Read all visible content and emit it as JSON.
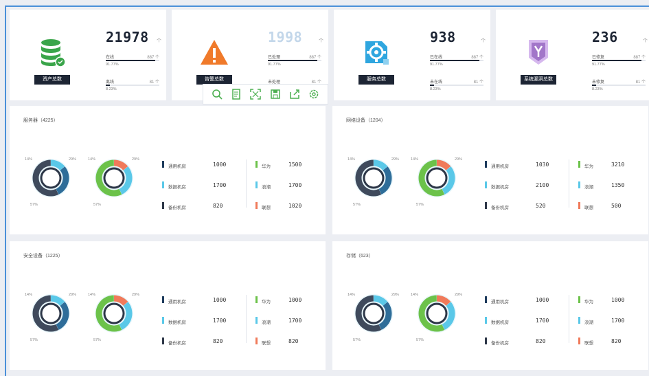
{
  "cards": [
    {
      "tag": "资产总数",
      "number": "21978",
      "unit": "个",
      "rows": [
        {
          "label": "在线",
          "value": "887 个",
          "pct": "91.77%",
          "fill": 0.92
        },
        {
          "label": "离线",
          "value": "81 个",
          "pct": "8.23%",
          "fill": 0.08
        }
      ],
      "color": "#3aa54a",
      "icon": "database-check-icon",
      "light": false
    },
    {
      "tag": "告警总数",
      "number": "1998",
      "unit": "个",
      "rows": [
        {
          "label": "已处理",
          "value": "887 个",
          "pct": "91.77%",
          "fill": 0.92
        },
        {
          "label": "未处理",
          "value": "81 个",
          "pct": "8.23%",
          "fill": 0.08
        }
      ],
      "color": "#f07a2a",
      "icon": "warning-triangle-icon",
      "light": true
    },
    {
      "tag": "服务总数",
      "number": "938",
      "unit": "个",
      "rows": [
        {
          "label": "已在线",
          "value": "887 个",
          "pct": "91.77%",
          "fill": 0.92
        },
        {
          "label": "未在线",
          "value": "81 个",
          "pct": "8.23%",
          "fill": 0.08
        }
      ],
      "color": "#2fa6df",
      "icon": "gear-service-icon",
      "light": false
    },
    {
      "tag": "系统漏洞总数",
      "number": "236",
      "unit": "个",
      "rows": [
        {
          "label": "已修复",
          "value": "887 个",
          "pct": "91.77%",
          "fill": 0.92
        },
        {
          "label": "未修复",
          "value": "81 个",
          "pct": "8.23%",
          "fill": 0.08
        }
      ],
      "color": "#a276c9",
      "icon": "shield-vulnerability-icon",
      "light": false
    }
  ],
  "toolbar": [
    "zoom-icon",
    "document-icon",
    "fullscreen-icon",
    "save-icon",
    "export-icon",
    "settings-icon"
  ],
  "panels": [
    {
      "title": "服务器（4225）",
      "left": [
        {
          "label": "通用机房",
          "value": "1000",
          "color": "#1d3b5c"
        },
        {
          "label": "数据机房",
          "value": "1700",
          "color": "#5ac8e8"
        },
        {
          "label": "备份机房",
          "value": "820",
          "color": "#2d3748"
        }
      ],
      "right": [
        {
          "label": "华为",
          "value": "1500",
          "color": "#6cc24a"
        },
        {
          "label": "浪潮",
          "value": "1700",
          "color": "#5ac8e8"
        },
        {
          "label": "联想",
          "value": "1020",
          "color": "#f07a5a"
        }
      ]
    },
    {
      "title": "网络设备（1204）",
      "left": [
        {
          "label": "通用机房",
          "value": "1030",
          "color": "#1d3b5c"
        },
        {
          "label": "数据机房",
          "value": "2100",
          "color": "#5ac8e8"
        },
        {
          "label": "备份机房",
          "value": "520",
          "color": "#2d3748"
        }
      ],
      "right": [
        {
          "label": "华为",
          "value": "3210",
          "color": "#6cc24a"
        },
        {
          "label": "浪潮",
          "value": "1350",
          "color": "#5ac8e8"
        },
        {
          "label": "联想",
          "value": "500",
          "color": "#f07a5a"
        }
      ]
    },
    {
      "title": "安全设备（1225）",
      "left": [
        {
          "label": "通用机房",
          "value": "1000",
          "color": "#1d3b5c"
        },
        {
          "label": "数据机房",
          "value": "1700",
          "color": "#5ac8e8"
        },
        {
          "label": "备份机房",
          "value": "820",
          "color": "#2d3748"
        }
      ],
      "right": [
        {
          "label": "华为",
          "value": "1000",
          "color": "#6cc24a"
        },
        {
          "label": "浪潮",
          "value": "1700",
          "color": "#5ac8e8"
        },
        {
          "label": "联想",
          "value": "820",
          "color": "#f07a5a"
        }
      ]
    },
    {
      "title": "存储（623）",
      "left": [
        {
          "label": "通用机房",
          "value": "1000",
          "color": "#1d3b5c"
        },
        {
          "label": "数据机房",
          "value": "1700",
          "color": "#5ac8e8"
        },
        {
          "label": "备份机房",
          "value": "820",
          "color": "#2d3748"
        }
      ],
      "right": [
        {
          "label": "华为",
          "value": "1000",
          "color": "#6cc24a"
        },
        {
          "label": "浪潮",
          "value": "1700",
          "color": "#5ac8e8"
        },
        {
          "label": "联想",
          "value": "820",
          "color": "#f07a5a"
        }
      ]
    }
  ],
  "donut_labels": {
    "tl": "14%",
    "tr": "29%",
    "bl": "57%"
  }
}
